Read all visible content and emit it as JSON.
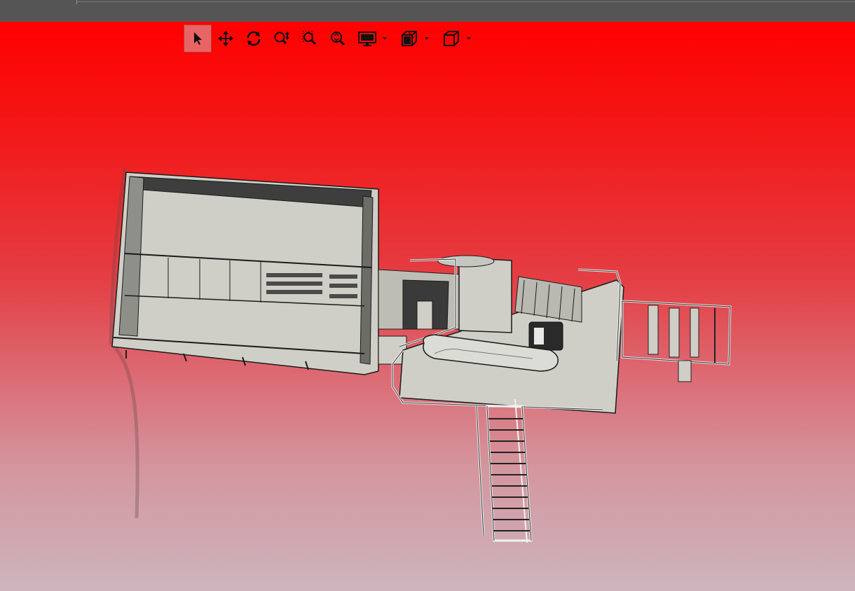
{
  "window": {
    "title_bar_color": "#555555"
  },
  "viewport": {
    "gradient_top": "#ff0000",
    "gradient_bottom": "#cdb5bd"
  },
  "toolbar": {
    "tools": [
      {
        "id": "select",
        "icon": "arrow-cursor-icon",
        "active": true
      },
      {
        "id": "pan",
        "icon": "move-arrows-icon",
        "active": false
      },
      {
        "id": "rotate",
        "icon": "rotate-icon",
        "active": false
      },
      {
        "id": "zoom",
        "icon": "zoom-updown-icon",
        "active": false
      },
      {
        "id": "zoom-window",
        "icon": "zoom-box-icon",
        "active": false
      },
      {
        "id": "zoom-fit",
        "icon": "zoom-fit-icon",
        "active": false
      },
      {
        "id": "display",
        "icon": "monitor-icon",
        "dropdown": true
      },
      {
        "id": "section",
        "icon": "section-cube-icon",
        "dropdown": true
      },
      {
        "id": "view-orientation",
        "icon": "cube-icon",
        "dropdown": true
      }
    ]
  },
  "model": {
    "icon": "cad-assembly-model",
    "colors": {
      "body": "#cfcfc8",
      "edge": "#1a1a1a",
      "dark": "#3a3a3a"
    }
  }
}
